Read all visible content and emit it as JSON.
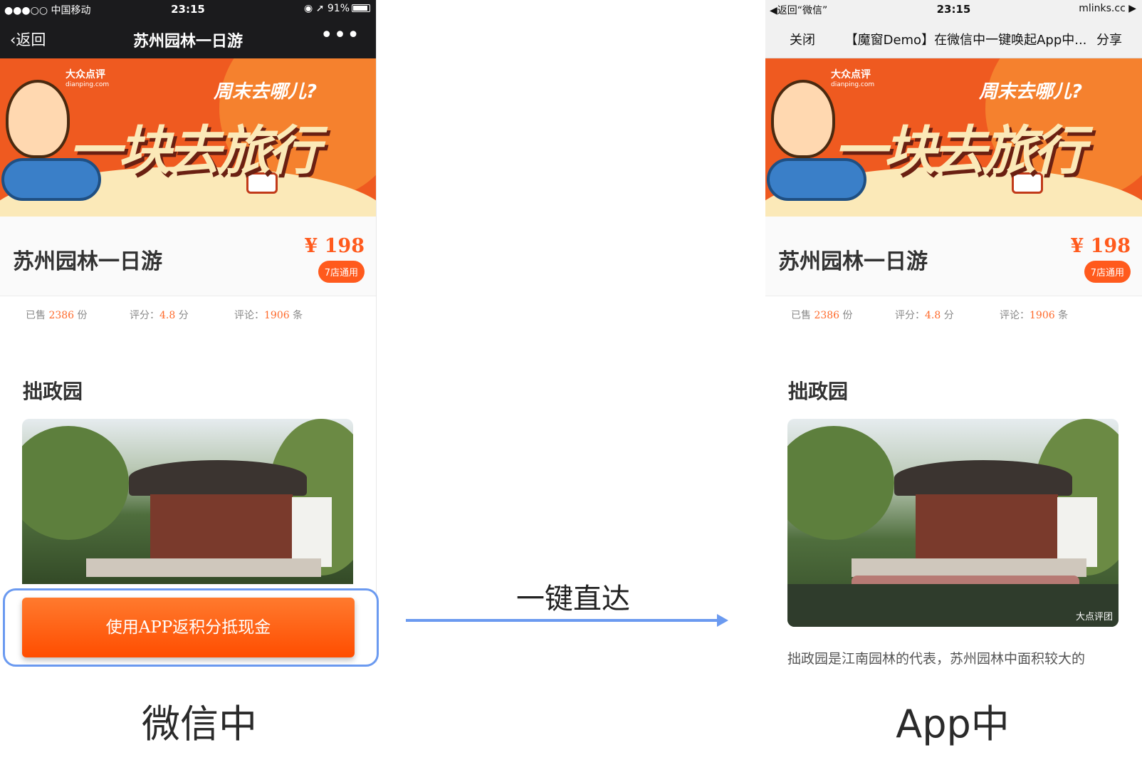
{
  "left_phone": {
    "status": {
      "carrier": "●●●○○ 中国移动 ",
      "time": "23:15",
      "battery": "◉ ➚ 91%"
    },
    "nav": {
      "back_label": "返回",
      "title": "苏州园林一日游",
      "more_label": "•••"
    },
    "banner": {
      "logo_text": "大众点评",
      "logo_sub": "dianping.com",
      "tagline": "周末去哪儿?",
      "slogan": "一块去旅行"
    },
    "product": {
      "name": "苏州园林一日游",
      "price": "¥ 198",
      "badge": "7店通用"
    },
    "stats": [
      {
        "label": "已售 ",
        "value": "2386",
        "unit": " 份"
      },
      {
        "label": "评分：",
        "value": "4.8",
        "unit": " 分"
      },
      {
        "label": "评论：",
        "value": "1906",
        "unit": " 条"
      }
    ],
    "section_title": "拙政园",
    "cta_label": "使用APP返积分抵现金"
  },
  "right_phone": {
    "status": {
      "back_to": "◀返回“微信”",
      "time": "23:15",
      "site": "mlinks.cc ▶"
    },
    "browser": {
      "close_label": "关闭",
      "page_title": "【魔窗Demo】在微信中一键唤起App中...",
      "share_label": "分享"
    },
    "banner": {
      "logo_text": "大众点评",
      "logo_sub": "dianping.com",
      "tagline": "周末去哪儿?",
      "slogan": "一块去旅行"
    },
    "product": {
      "name": "苏州园林一日游",
      "price": "¥ 198",
      "badge": "7店通用"
    },
    "stats": [
      {
        "label": "已售 ",
        "value": "2386",
        "unit": " 份"
      },
      {
        "label": "评分：",
        "value": "4.8",
        "unit": " 分"
      },
      {
        "label": "评论：",
        "value": "1906",
        "unit": " 条"
      }
    ],
    "section_title": "拙政园",
    "photo_watermark": "大点评团",
    "description": "拙政园是江南园林的代表，苏州园林中面积较大的"
  },
  "arrow_label": "一键直达",
  "captions": {
    "left": "微信中",
    "right": "App中"
  },
  "colors": {
    "accent_orange": "#ff5a1d",
    "highlight_blue": "#6b9af0",
    "wechat_bar": "#1b1b1d"
  }
}
